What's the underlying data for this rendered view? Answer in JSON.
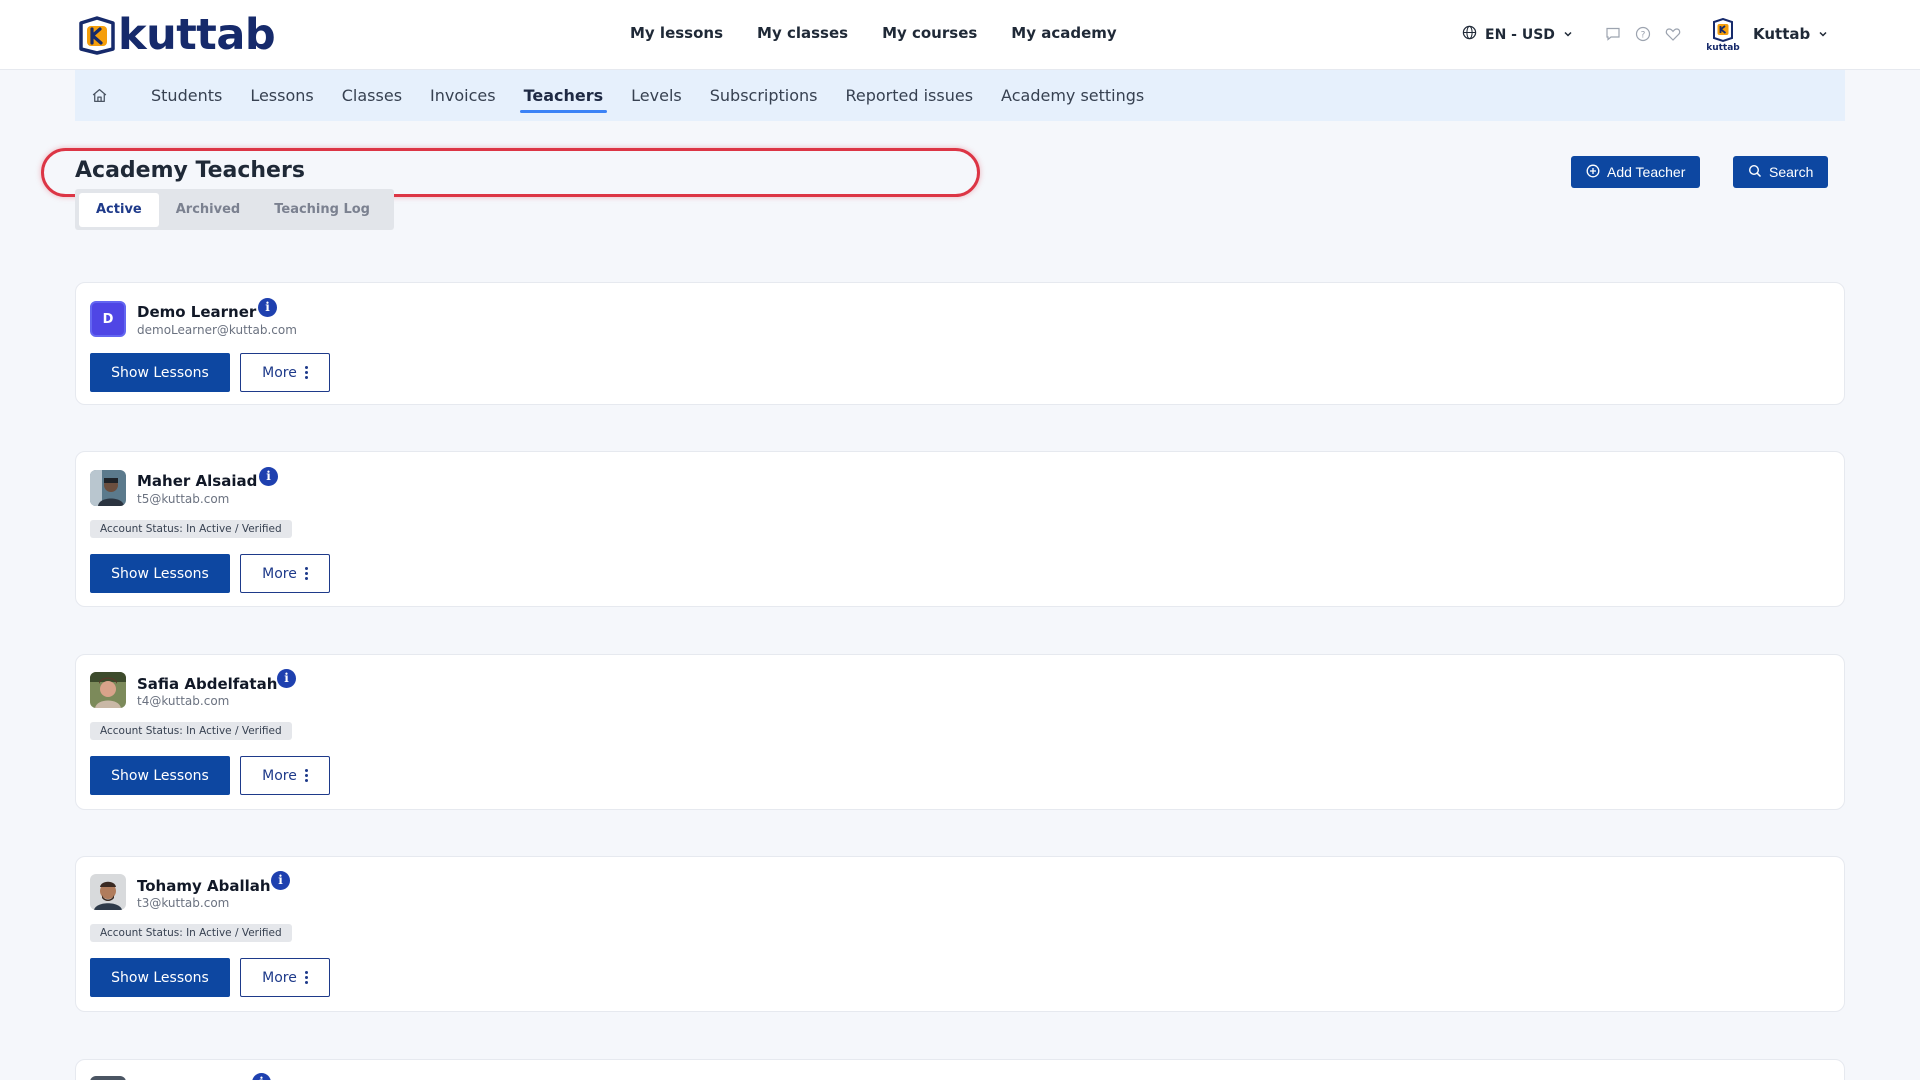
{
  "brand": {
    "name": "kuttab",
    "mark_letter": "K"
  },
  "main_nav": [
    "My lessons",
    "My classes",
    "My courses",
    "My academy"
  ],
  "locale": {
    "label": "EN - USD"
  },
  "user": {
    "name": "Kuttab",
    "logo_caption": "kuttab"
  },
  "sub_nav": {
    "items": [
      "Students",
      "Lessons",
      "Classes",
      "Invoices",
      "Teachers",
      "Levels",
      "Subscriptions",
      "Reported issues",
      "Academy settings"
    ],
    "active": "Teachers"
  },
  "page": {
    "title": "Academy Teachers",
    "tabs": [
      "Active",
      "Archived",
      "Teaching Log"
    ],
    "active_tab": "Active",
    "add_button": "Add Teacher",
    "search_button": "Search"
  },
  "teachers": [
    {
      "name": "Demo Learner",
      "email": "demoLearner@kuttab.com",
      "avatar_letter": "D",
      "status": "",
      "show_label": "Show Lessons",
      "more_label": "More"
    },
    {
      "name": "Maher Alsaiad",
      "email": "t5@kuttab.com",
      "avatar_letter": "",
      "status": "Account Status: In Active / Verified",
      "show_label": "Show Lessons",
      "more_label": "More"
    },
    {
      "name": "Safia Abdelfatah",
      "email": "t4@kuttab.com",
      "avatar_letter": "",
      "status": "Account Status: In Active / Verified",
      "show_label": "Show Lessons",
      "more_label": "More"
    },
    {
      "name": "Tohamy Aballah",
      "email": "t3@kuttab.com",
      "avatar_letter": "",
      "status": "Account Status: In Active / Verified",
      "show_label": "Show Lessons",
      "more_label": "More"
    }
  ],
  "colors": {
    "primary": "#0d47a1",
    "highlight": "#dc3545",
    "subnav_bg": "#e6f0fc",
    "active_underline": "#3b82f6"
  }
}
